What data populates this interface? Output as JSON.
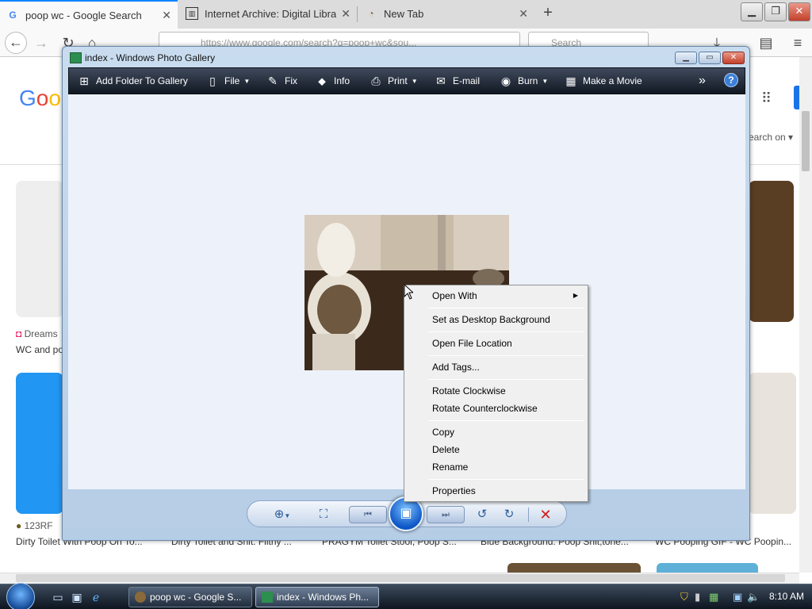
{
  "browser": {
    "tabs": [
      {
        "title": "poop wc - Google Search",
        "icon": "google-g-icon"
      },
      {
        "title": "Internet Archive: Digital Library",
        "icon": "archive-icon"
      },
      {
        "title": "New Tab",
        "icon": "firefox-icon"
      }
    ],
    "url": "https://www.google.com/search?q=poop+wc&sou...",
    "search_placeholder": "Search"
  },
  "google": {
    "logo": "Goo",
    "search_on": "earch on ▾",
    "row1": [
      {
        "source": "Dreams",
        "caption": "WC and po"
      }
    ],
    "row2": [
      {
        "source": "123RF",
        "caption": "Dirty Toilet With Poop On To..."
      },
      {
        "source": "",
        "caption": "Dirty Toilet and Shit. Filthy ..."
      },
      {
        "source": "",
        "caption": "PRAGYM Toilet Stool, Poop S..."
      },
      {
        "source": "",
        "caption": "Blue Background. Poop Shit,tone..."
      },
      {
        "source": "",
        "caption": "WC Pooping GIF - WC Poopin..."
      }
    ]
  },
  "gallery": {
    "title": "index - Windows Photo Gallery",
    "toolbar": {
      "add_folder": "Add Folder To Gallery",
      "file": "File",
      "fix": "Fix",
      "info": "Info",
      "print": "Print",
      "email": "E-mail",
      "burn": "Burn",
      "make_movie": "Make a Movie",
      "more": "»",
      "help": "?"
    }
  },
  "context_menu": {
    "open_with": "Open With",
    "set_background": "Set as Desktop Background",
    "open_location": "Open File Location",
    "add_tags": "Add Tags...",
    "rotate_cw": "Rotate Clockwise",
    "rotate_ccw": "Rotate Counterclockwise",
    "copy": "Copy",
    "delete": "Delete",
    "rename": "Rename",
    "properties": "Properties"
  },
  "taskbar": {
    "tasks": [
      {
        "label": "poop wc - Google S..."
      },
      {
        "label": "index - Windows Ph..."
      }
    ],
    "clock": "8:10 AM"
  },
  "colors": {
    "accent": "#0a84ff",
    "gallery_toolbar": "#1a2230",
    "delete_red": "#d11b1b"
  }
}
